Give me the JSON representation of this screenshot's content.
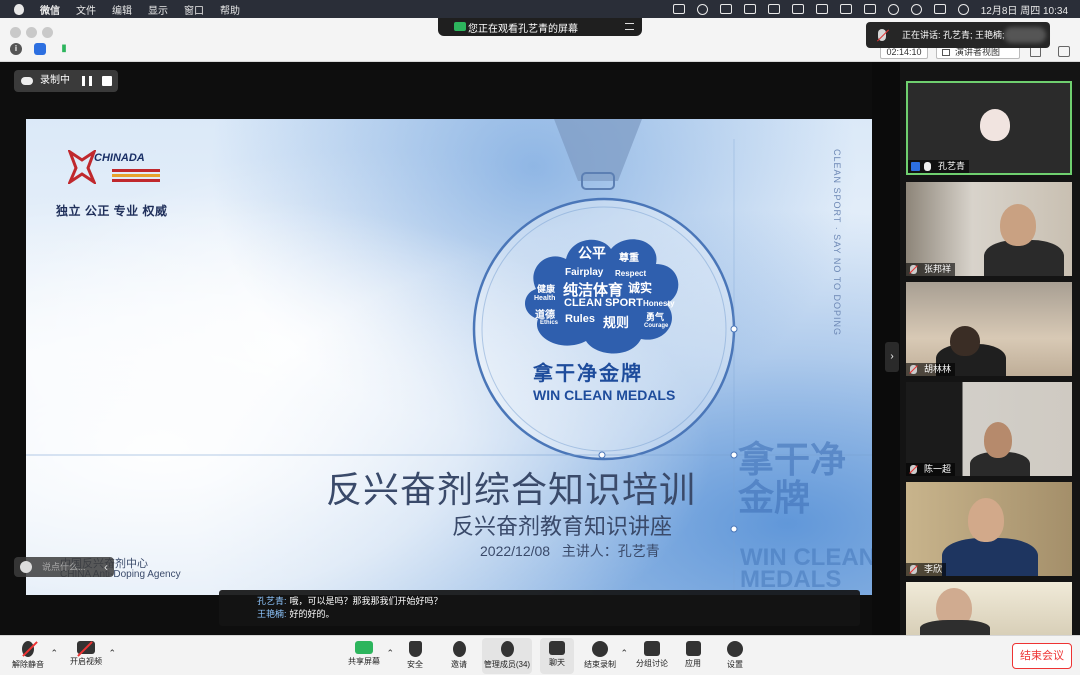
{
  "menubar": {
    "app": "微信",
    "items": [
      "文件",
      "编辑",
      "显示",
      "窗口",
      "帮助"
    ],
    "clock": "12月8日 周四  10:34"
  },
  "share_banner": {
    "text": "您正在观看孔艺青的屏幕"
  },
  "talking": {
    "text": "正在讲话: 孔艺青; 王艳楠;"
  },
  "timer": "02:14:10",
  "view_button": "演讲者视图",
  "recording": {
    "label": "录制中"
  },
  "slide": {
    "brand": "CHINADA",
    "tagline": "独立 公正 专业 权威",
    "vertical": "CLEAN SPORT · SAY NO TO DOPING",
    "cloud_words": {
      "fair": "公平",
      "respect_cn": "尊重",
      "fairplay": "Fairplay",
      "respect": "Respect",
      "health_cn": "健康",
      "pure": "纯洁体育",
      "honest_cn": "诚实",
      "health": "Health",
      "clean_sport": "CLEAN SPORT",
      "honesty": "Honesty",
      "ethics_cn": "道德",
      "ethics": "Ethics",
      "rules": "Rules",
      "rules_cn": "规则",
      "courage_cn": "勇气",
      "courage": "Courage"
    },
    "medal_cn": "拿干净金牌",
    "medal_en": "WIN CLEAN MEDALS",
    "big_right_cn": "拿干净\n金牌",
    "big_right_en": "WIN CLEAN\nMEDALS",
    "title": "反兴奋剂综合知识培训",
    "subtitle": "反兴奋剂教育知识讲座",
    "date_line": "2022/12/08   主讲人：孔艺青",
    "org_cn": "中国反兴奋剂中心",
    "org_en": "CHINA Anti-Doping Agency"
  },
  "say_bar": {
    "placeholder": "说点什么..."
  },
  "captions": [
    {
      "who": "孔艺青:",
      "text": "哦，可以是吗？那我那我们开始好吗？"
    },
    {
      "who": "王艳楠:",
      "text": "好的好的。"
    }
  ],
  "participants": [
    {
      "name": "孔艺青"
    },
    {
      "name": "张邦祥"
    },
    {
      "name": "胡林林"
    },
    {
      "name": "陈一超"
    },
    {
      "name": "李欣"
    }
  ],
  "toolbar": {
    "unmute": "解除静音",
    "start_video": "开启视频",
    "share": "共享屏幕",
    "security": "安全",
    "invite": "邀请",
    "manage": "管理成员(34)",
    "chat": "聊天",
    "end_record": "结束录制",
    "breakout": "分组讨论",
    "apps": "应用",
    "settings": "设置",
    "end_meeting": "结束会议"
  },
  "colors": {
    "accent_green": "#2db55d",
    "end_red": "#e33333",
    "medal_blue": "#1e4c9c"
  }
}
